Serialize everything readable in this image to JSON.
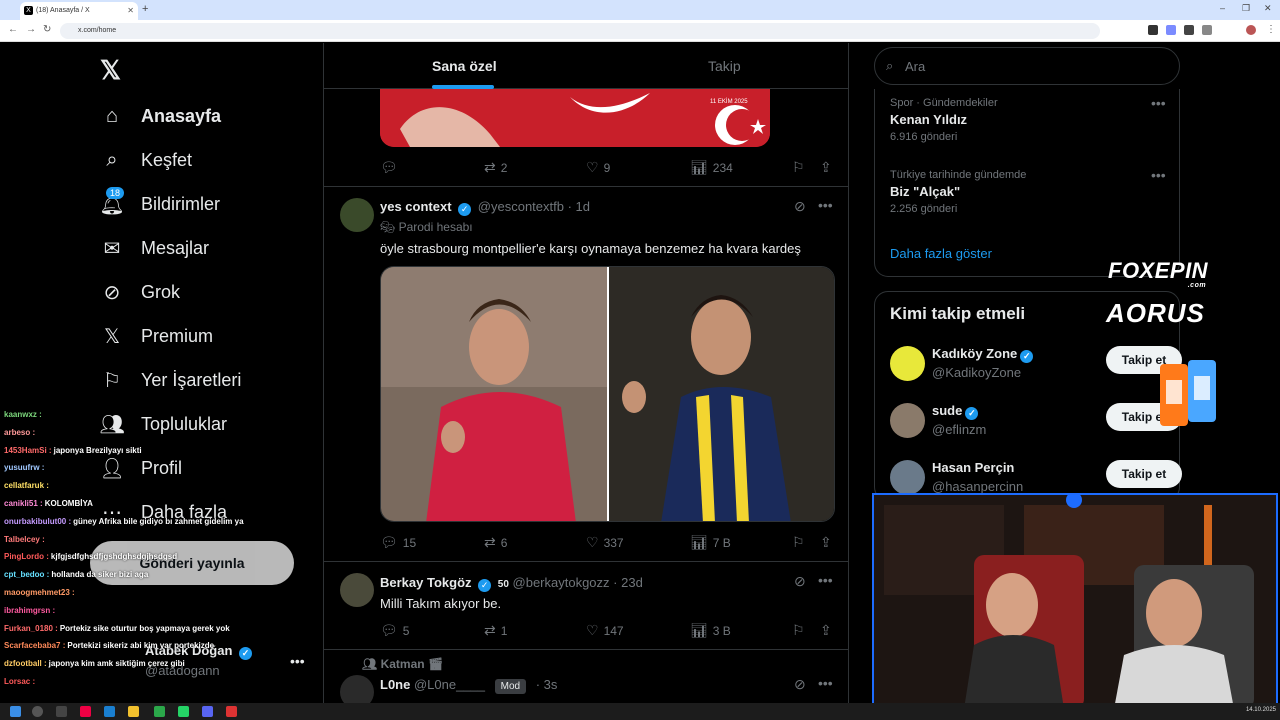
{
  "browser": {
    "tab_title": "(18) Anasayfa / X",
    "url": "x.com/home",
    "tab_icon": "x-icon"
  },
  "nav": {
    "items": [
      {
        "label": "Anasayfa",
        "icon": "home-icon"
      },
      {
        "label": "Keşfet",
        "icon": "search-icon"
      },
      {
        "label": "Bildirimler",
        "icon": "bell-icon"
      },
      {
        "label": "Mesajlar",
        "icon": "mail-icon"
      },
      {
        "label": "Grok",
        "icon": "grok-icon"
      },
      {
        "label": "Premium",
        "icon": "x-icon"
      },
      {
        "label": "Yer İşaretleri",
        "icon": "bookmark-icon"
      },
      {
        "label": "Topluluklar",
        "icon": "people-icon"
      },
      {
        "label": "Profil",
        "icon": "person-icon"
      },
      {
        "label": "Daha fazla",
        "icon": "more-circle-icon"
      }
    ],
    "notif_count": "18",
    "post_button": "Gönderi yayınla",
    "profile_name": "Atabek Doğan",
    "profile_handle": "@atadogann"
  },
  "feed": {
    "tabs": [
      "Sana özel",
      "Takip"
    ],
    "post0": {
      "replies": "",
      "reposts": "2",
      "likes": "9",
      "views": "234",
      "media_text": "11 EKİM 2025"
    },
    "post1": {
      "name": "yes context",
      "handle": "@yescontextfb",
      "time": "· 1d",
      "label": "Parodi hesabı",
      "text": "öyle strasbourg montpellier'e karşı oynamaya benzemez ha kvara kardeş",
      "replies": "15",
      "reposts": "6",
      "likes": "337",
      "views": "7 B"
    },
    "post2": {
      "name": "Berkay Tokgöz",
      "badge": "50",
      "handle": "@berkaytokgozz",
      "time": "· 23d",
      "text": "Milli Takım akıyor be.",
      "replies": "5",
      "reposts": "1",
      "likes": "147",
      "views": "3 B"
    },
    "post3": {
      "context": "Katman",
      "name": "L0ne",
      "handle": "@L0ne____",
      "mod": "Mod",
      "time": "· 3s"
    }
  },
  "sidebar": {
    "search_placeholder": "Ara",
    "trends": [
      {
        "category": "Spor · Gündemdekiler",
        "title": "Kenan Yıldız",
        "count": "6.916 gönderi"
      },
      {
        "category": "Türkiye tarihinde gündemde",
        "title": "Biz \"Alçak\"",
        "count": "2.256 gönderi"
      }
    ],
    "show_more": "Daha fazla göster",
    "follow_title": "Kimi takip etmeli",
    "follow": [
      {
        "name": "Kadıköy Zone",
        "handle": "@KadikoyZone",
        "button": "Takip et"
      },
      {
        "name": "sude",
        "handle": "@eflinzm",
        "button": "Takip et"
      },
      {
        "name": "Hasan Perçin",
        "handle": "@hasanpercinn",
        "button": "Takip et"
      }
    ]
  },
  "overlay": {
    "sponsor1": "FOXEPIN",
    "sponsor1_sub": ".com",
    "sponsor2": "AORUS",
    "chat": [
      {
        "user": "kaanwxz :",
        "msg": ""
      },
      {
        "user": "arbeso :",
        "msg": ""
      },
      {
        "user": "1453HamSi :",
        "msg": "japonya Brezilyayı sikti"
      },
      {
        "user": "yusuufrw :",
        "msg": ""
      },
      {
        "user": "cellatfaruk :",
        "msg": ""
      },
      {
        "user": "canikli51 :",
        "msg": "KOLOMBİYA"
      },
      {
        "user": "onurbakibulut00 :",
        "msg": "güney Afrika bile gidiyo bı zahmet gidelim ya"
      },
      {
        "user": "Talbelcey :",
        "msg": ""
      },
      {
        "user": "PingLordo :",
        "msg": "kjfgjsdfghsdfjgshdghsdgjhsdgsd"
      },
      {
        "user": "cpt_bedoo :",
        "msg": "hollanda da siker bizi aga"
      },
      {
        "user": "maoogmehmet23 :",
        "msg": ""
      },
      {
        "user": "ibrahimgrsn :",
        "msg": ""
      },
      {
        "user": "Furkan_0180 :",
        "msg": "Portekiz sike oturtur boş yapmaya gerek yok"
      },
      {
        "user": "Scarfacebaba7 :",
        "msg": "Portekizi sikeriz abi kim var portekizde"
      },
      {
        "user": "dzfootball :",
        "msg": "japonya kim amk siktiğim çerez gibi"
      },
      {
        "user": "Lorsac :",
        "msg": ""
      }
    ],
    "date": "14.10.2025"
  },
  "colors": {
    "accent": "#1d9bf0",
    "background": "#000000",
    "text": "#e7e9ea",
    "muted": "#71767b"
  }
}
